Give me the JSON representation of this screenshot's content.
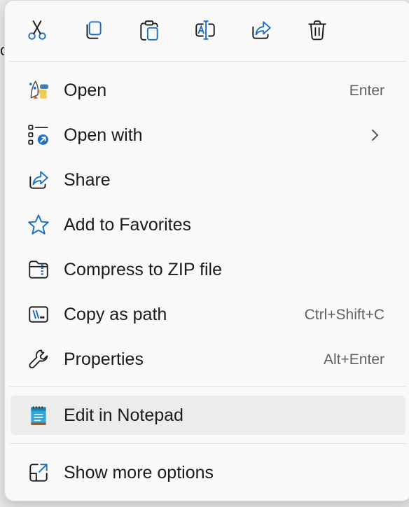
{
  "backdrop": {
    "left_char": "c",
    "right_char": "/"
  },
  "toolbar": {
    "cut": "scissors-icon",
    "copy": "copy-icon",
    "paste": "clipboard-icon",
    "rename": "rename-icon",
    "share": "share-icon",
    "delete": "trash-icon"
  },
  "items": [
    {
      "label": "Open",
      "shortcut": "Enter",
      "icon": "python-file-icon"
    },
    {
      "label": "Open with",
      "shortcut": "",
      "icon": "open-with-icon",
      "submenu": true
    },
    {
      "label": "Share",
      "shortcut": "",
      "icon": "share-icon"
    },
    {
      "label": "Add to Favorites",
      "shortcut": "",
      "icon": "star-icon"
    },
    {
      "label": "Compress to ZIP file",
      "shortcut": "",
      "icon": "zip-folder-icon"
    },
    {
      "label": "Copy as path",
      "shortcut": "Ctrl+Shift+C",
      "icon": "copy-path-icon"
    },
    {
      "label": "Properties",
      "shortcut": "Alt+Enter",
      "icon": "wrench-icon"
    },
    {
      "label": "Edit in Notepad",
      "shortcut": "",
      "icon": "notepad-icon"
    },
    {
      "label": "Show more options",
      "shortcut": "",
      "icon": "show-more-icon"
    }
  ],
  "colors": {
    "accent": "#1a6fc4",
    "menu_bg": "#f9f9f9",
    "hover_bg": "#ececec"
  }
}
